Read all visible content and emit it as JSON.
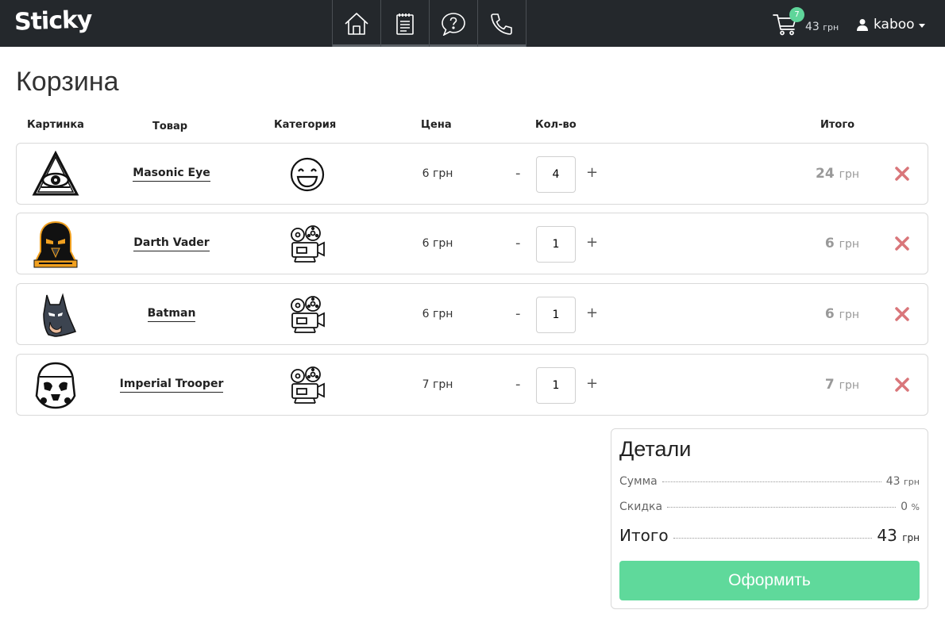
{
  "header": {
    "logo": "Sticky",
    "nav": [
      {
        "name": "home-icon"
      },
      {
        "name": "notepad-icon"
      },
      {
        "name": "question-icon"
      },
      {
        "name": "phone-icon"
      }
    ],
    "cart_count": "7",
    "cart_total_value": "43",
    "cart_total_unit": "грн",
    "username": "kaboo"
  },
  "page": {
    "title": "Корзина"
  },
  "table": {
    "headers": {
      "image": "Картинка",
      "product": "Товар",
      "category": "Категория",
      "price": "Цена",
      "qty": "Кол-во",
      "total": "Итого"
    },
    "rows": [
      {
        "name": "Masonic Eye",
        "category_icon": "smiley-icon",
        "price": "6 грн",
        "qty": "4",
        "total": "24",
        "unit": "грн",
        "image_icon": "all-seeing-eye-icon"
      },
      {
        "name": "Darth Vader",
        "category_icon": "film-projector-icon",
        "price": "6 грн",
        "qty": "1",
        "total": "6",
        "unit": "грн",
        "image_icon": "darth-vader-icon"
      },
      {
        "name": "Batman",
        "category_icon": "film-projector-icon",
        "price": "6 грн",
        "qty": "1",
        "total": "6",
        "unit": "грн",
        "image_icon": "batman-icon"
      },
      {
        "name": "Imperial Trooper",
        "category_icon": "film-projector-icon",
        "price": "7 грн",
        "qty": "1",
        "total": "7",
        "unit": "грн",
        "image_icon": "stormtrooper-icon"
      }
    ],
    "minus_label": "-",
    "plus_label": "+"
  },
  "details": {
    "title": "Детали",
    "sum_label": "Сумма",
    "sum_value": "43",
    "sum_unit": "грн",
    "discount_label": "Скидка",
    "discount_value": "0",
    "discount_unit": "%",
    "total_label": "Итого",
    "total_value": "43",
    "total_unit": "грн",
    "checkout_label": "Оформить"
  },
  "colors": {
    "navbar": "#24282c",
    "accent_green": "#5fd99b",
    "remove_red": "#d9767a"
  }
}
